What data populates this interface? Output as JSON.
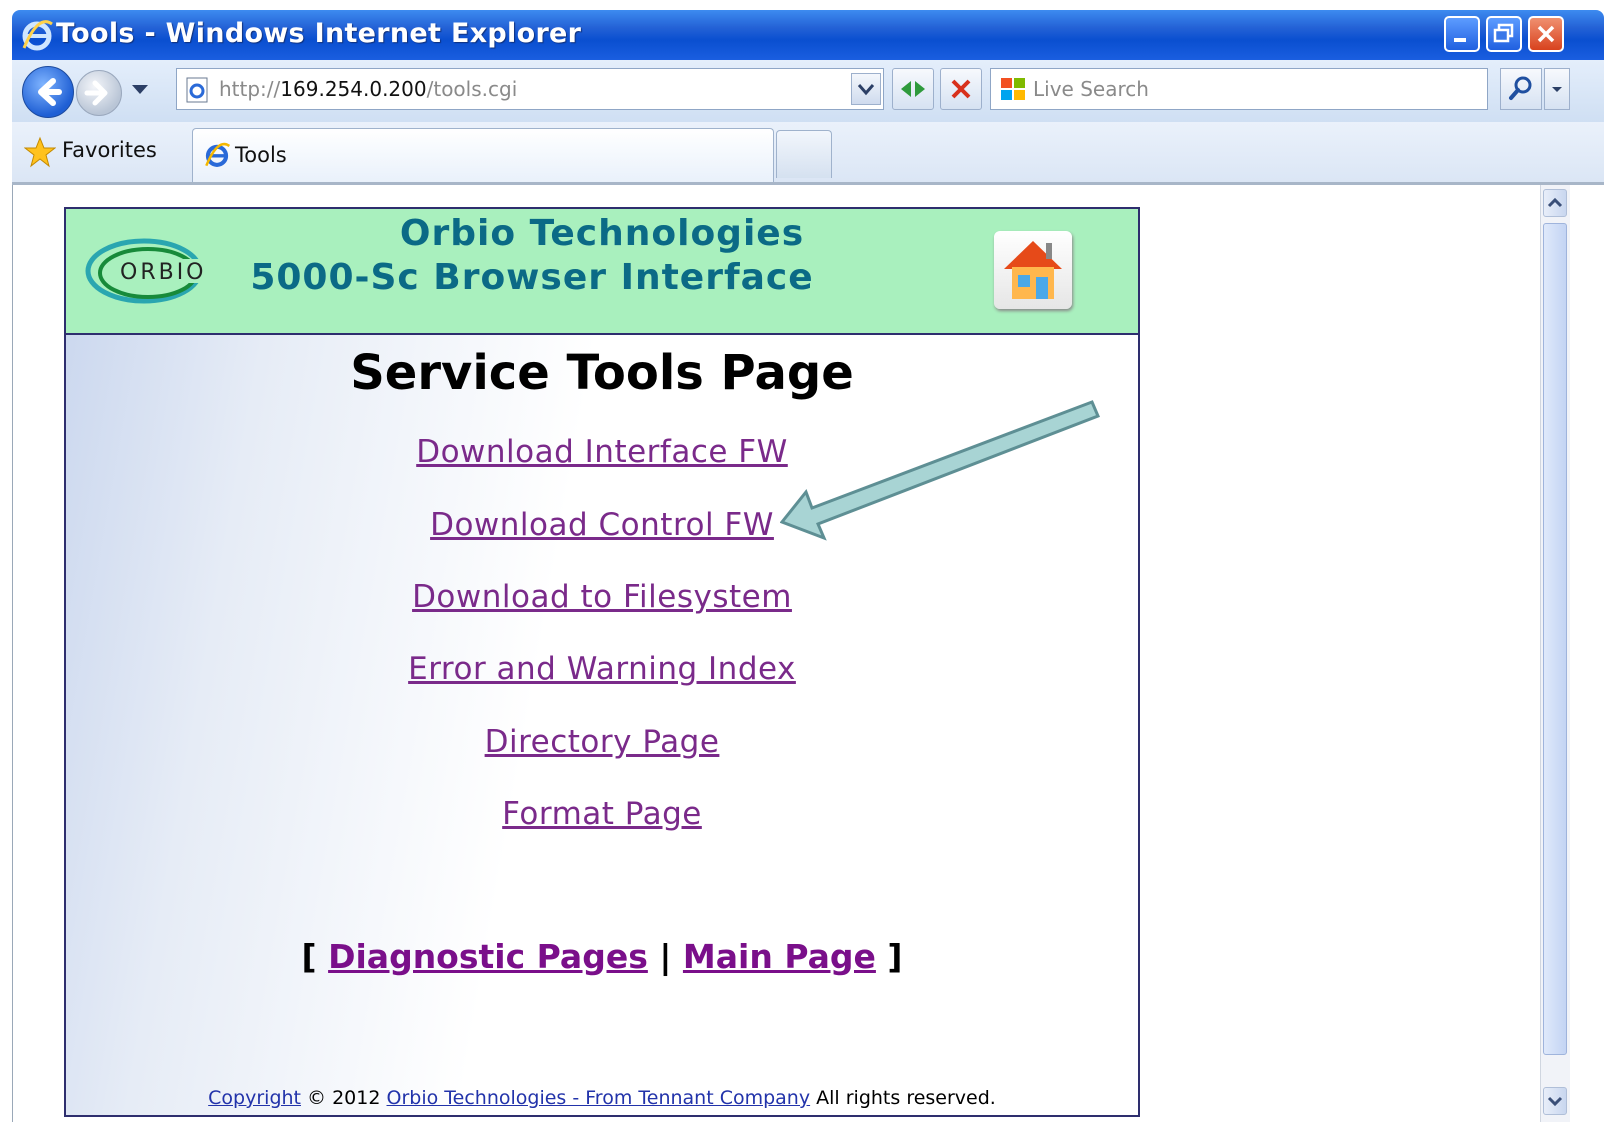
{
  "window": {
    "title": "Tools - Windows Internet Explorer"
  },
  "toolbar": {
    "address_prefix": "http://",
    "address_host": "169.254.0.200",
    "address_path": "/tools.cgi",
    "search_placeholder": "Live Search"
  },
  "favorites": {
    "label": "Favorites"
  },
  "tab": {
    "label": "Tools"
  },
  "header": {
    "company": "Orbio Technologies",
    "product": "5000-Sc Browser Interface",
    "logo_text": "ORBIO"
  },
  "page": {
    "title": "Service Tools Page",
    "links": [
      "Download Interface FW",
      "Download Control FW",
      "Download to Filesystem",
      "Error and Warning Index",
      "Directory Page",
      "Format Page"
    ],
    "nav": {
      "open_bracket": "[",
      "diagnostic": "Diagnostic Pages",
      "separator": "|",
      "main": "Main Page",
      "close_bracket": "]"
    },
    "footer": {
      "copyright_link": "Copyright",
      "year_text": "© 2012",
      "company_link": "Orbio Technologies - From Tennant Company",
      "rights": "All rights reserved."
    }
  },
  "colors": {
    "header_bg": "#a9f0be",
    "brand_text": "#0b6a86",
    "link": "#7a2a8a",
    "arrow": "#a8d4d4"
  }
}
